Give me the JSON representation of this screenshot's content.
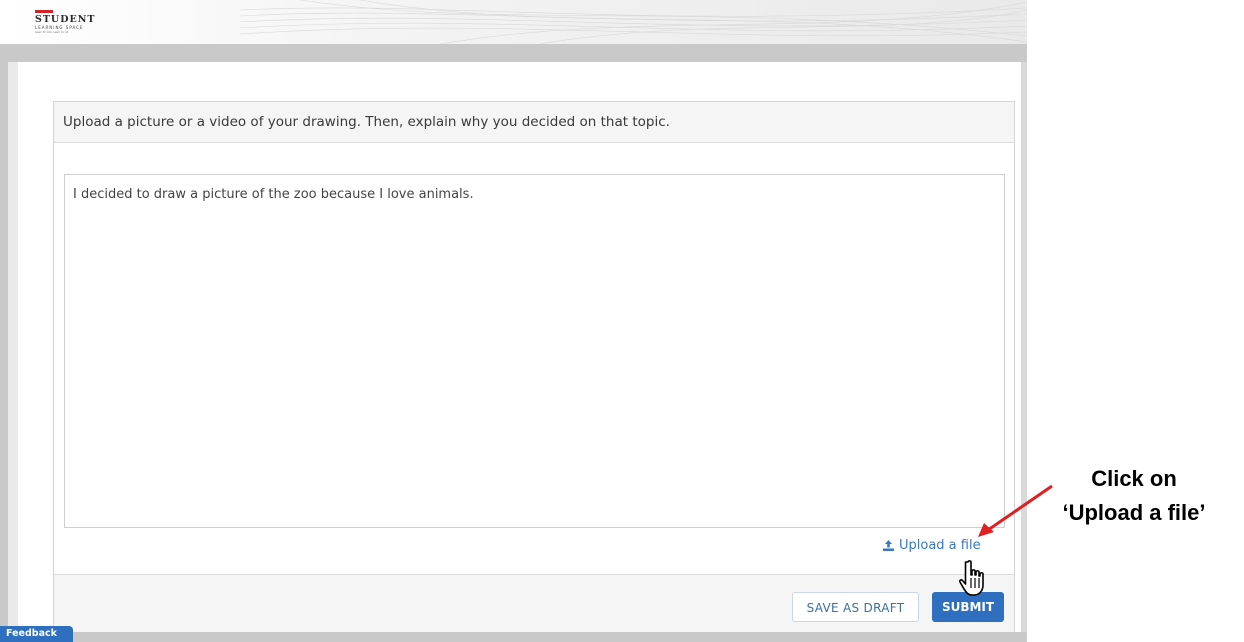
{
  "header": {
    "logo_line1": "STUDENT",
    "logo_line2": "LEARNING SPACE",
    "logo_tag": "Learn for Life, Learn for All",
    "brand_color": "#d6232a"
  },
  "question": {
    "prompt": "Upload a picture or a video of your drawing. Then, explain why you decided on that topic."
  },
  "answer": {
    "text": "I decided to draw a picture of the zoo because I love animals."
  },
  "upload": {
    "label": "Upload a file",
    "icon": "upload-icon"
  },
  "footer": {
    "save_draft_label": "SAVE AS DRAFT",
    "submit_label": "SUBMIT",
    "accent_color": "#2f6fbf"
  },
  "feedback": {
    "label": "Feedback"
  },
  "annotation": {
    "line1": "Click on",
    "line2": "‘Upload a file’",
    "arrow_color": "#e02020"
  }
}
